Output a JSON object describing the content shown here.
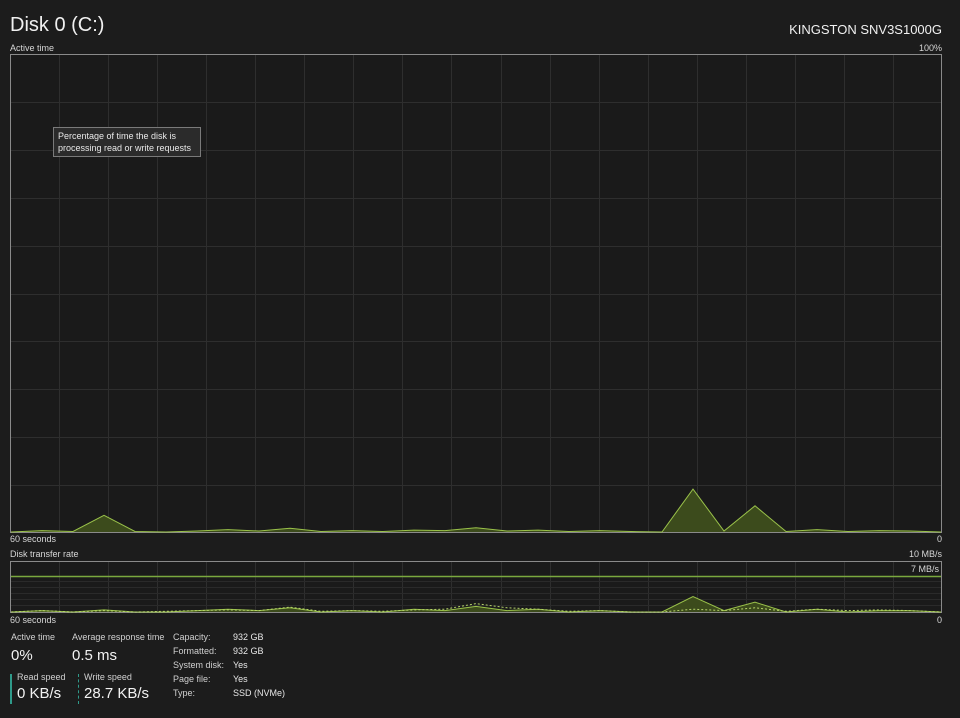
{
  "header": {
    "title": "Disk 0 (C:)",
    "model": "KINGSTON SNV3S1000G"
  },
  "active_time_graph": {
    "label": "Active time",
    "max_label": "100%",
    "time_label": "60 seconds",
    "min_label": "0",
    "tooltip": "Percentage of time the disk is processing read or write requests",
    "line_color": "#9ac24a",
    "fill_color": "#3c4b1c"
  },
  "transfer_graph": {
    "label": "Disk transfer rate",
    "max_label": "10 MB/s",
    "ref_label": "7 MB/s",
    "time_label": "60 seconds",
    "min_label": "0",
    "ref_line_color": "#7aa83e"
  },
  "stats": {
    "active_time": {
      "label": "Active time",
      "value": "0%"
    },
    "avg_response": {
      "label": "Average response time",
      "value": "0.5 ms"
    },
    "read_speed": {
      "label": "Read speed",
      "value": "0 KB/s"
    },
    "write_speed": {
      "label": "Write speed",
      "value": "28.7 KB/s"
    }
  },
  "properties": [
    {
      "key": "Capacity:",
      "value": "932 GB"
    },
    {
      "key": "Formatted:",
      "value": "932 GB"
    },
    {
      "key": "System disk:",
      "value": "Yes"
    },
    {
      "key": "Page file:",
      "value": "Yes"
    },
    {
      "key": "Type:",
      "value": "SSD (NVMe)"
    }
  ],
  "chart_data": [
    {
      "type": "area",
      "title": "Active time",
      "ylabel": "",
      "ylim": [
        0,
        100
      ],
      "x_label": "60 seconds",
      "x": [
        0,
        2,
        4,
        6,
        8,
        10,
        12,
        14,
        16,
        18,
        20,
        22,
        24,
        26,
        28,
        30,
        32,
        34,
        36,
        38,
        40,
        42,
        44,
        46,
        48,
        50,
        52,
        54,
        56,
        58,
        60
      ],
      "values": [
        0,
        0.3,
        0.1,
        3.5,
        0.1,
        0,
        0.2,
        0.5,
        0.2,
        0.8,
        0.1,
        0.3,
        0.1,
        0.4,
        0.3,
        0.9,
        0.2,
        0.4,
        0.1,
        0.3,
        0.1,
        0,
        9,
        0.2,
        5.5,
        0.1,
        0.5,
        0.1,
        0.3,
        0.2,
        0
      ]
    },
    {
      "type": "line",
      "title": "Disk transfer rate",
      "ylabel": "",
      "ylim": [
        0,
        10
      ],
      "ref_line": 7,
      "x_label": "60 seconds",
      "series": [
        {
          "values": [
            0,
            0.1,
            0,
            0.15,
            0,
            0,
            0.1,
            0.2,
            0.1,
            0.3,
            0,
            0.1,
            0,
            0.2,
            0.1,
            0.4,
            0.1,
            0.2,
            0,
            0.1,
            0,
            0,
            1.1,
            0.1,
            0.7,
            0,
            0.2,
            0,
            0.1,
            0.1,
            0
          ]
        }
      ],
      "dashed_series": [
        0,
        0.1,
        0,
        0.1,
        0,
        0.05,
        0.1,
        0.15,
        0.1,
        0.35,
        0.05,
        0.1,
        0.05,
        0.15,
        0.2,
        0.6,
        0.3,
        0.2,
        0.05,
        0.1,
        0,
        0,
        0.2,
        0.1,
        0.3,
        0.05,
        0.2,
        0.1,
        0.15,
        0.1,
        0
      ]
    }
  ]
}
